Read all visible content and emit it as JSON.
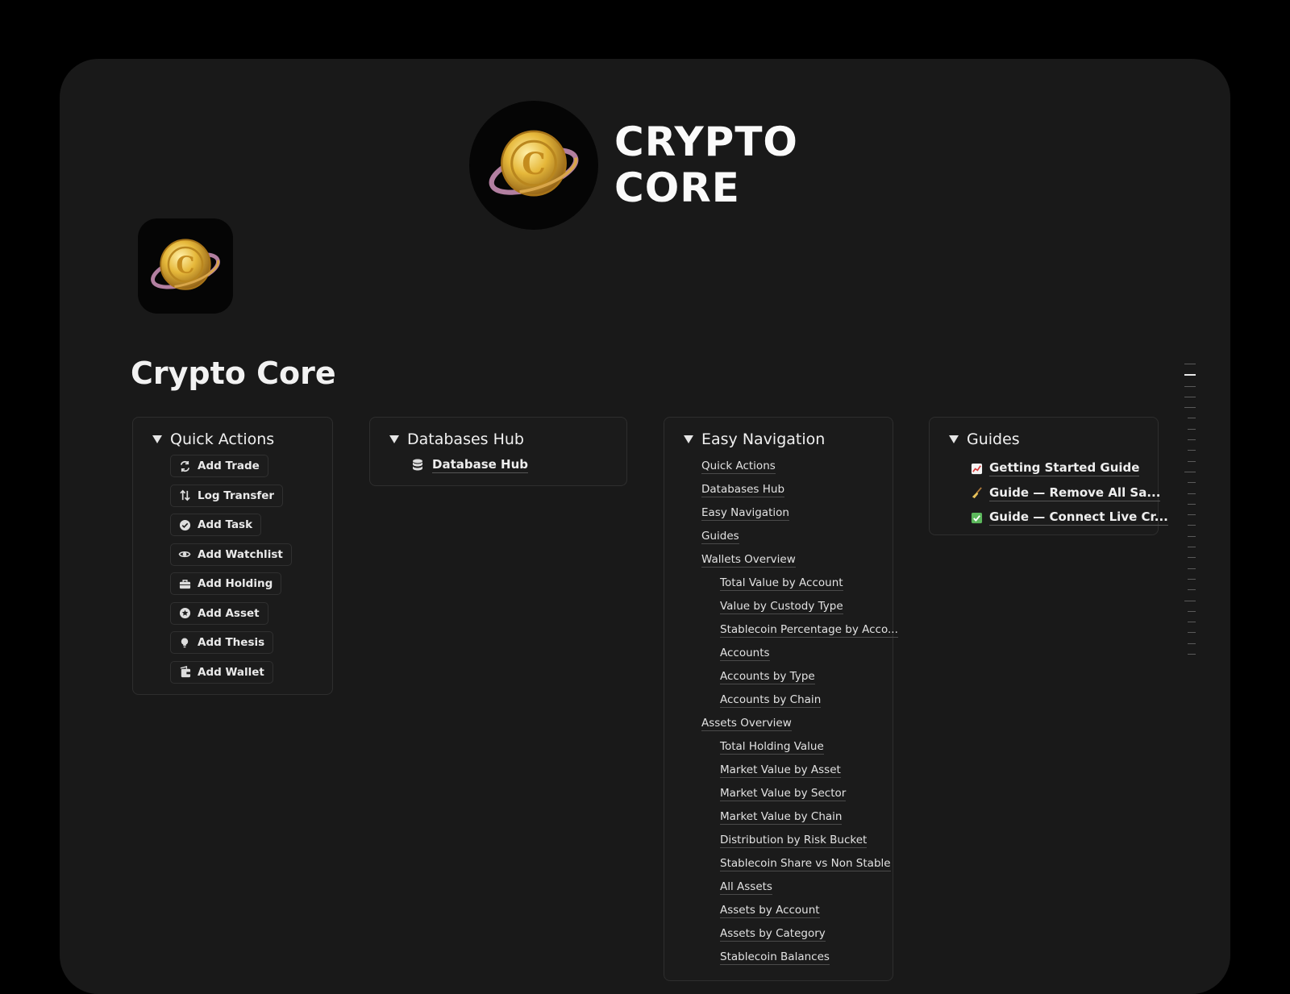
{
  "cover": {
    "title_line1": "CRYPTO",
    "title_line2": "CORE",
    "logo_icon": "gold-coin-orbit-icon"
  },
  "page": {
    "icon": "gold-coin-orbit-icon",
    "title": "Crypto Core"
  },
  "quick_actions": {
    "heading": "Quick Actions",
    "buttons": [
      {
        "label": "Add Trade",
        "icon": "swap-arrows-icon"
      },
      {
        "label": "Log Transfer",
        "icon": "up-down-arrows-icon"
      },
      {
        "label": "Add Task",
        "icon": "check-circle-icon"
      },
      {
        "label": "Add Watchlist",
        "icon": "eye-icon"
      },
      {
        "label": "Add Holding",
        "icon": "briefcase-icon"
      },
      {
        "label": "Add Asset",
        "icon": "star-circle-icon"
      },
      {
        "label": "Add Thesis",
        "icon": "lightbulb-icon"
      },
      {
        "label": "Add Wallet",
        "icon": "wallet-icon"
      }
    ]
  },
  "databases_hub": {
    "heading": "Databases Hub",
    "link": {
      "label": "Database Hub",
      "icon": "database-icon"
    }
  },
  "easy_navigation": {
    "heading": "Easy Navigation",
    "items": [
      {
        "label": "Quick Actions",
        "level": 0
      },
      {
        "label": "Databases Hub",
        "level": 0
      },
      {
        "label": "Easy Navigation",
        "level": 0
      },
      {
        "label": "Guides",
        "level": 0
      },
      {
        "label": "Wallets Overview",
        "level": 0
      },
      {
        "label": "Total Value by Account",
        "level": 1
      },
      {
        "label": "Value by Custody Type",
        "level": 1
      },
      {
        "label": "Stablecoin Percentage by Acco...",
        "level": 1
      },
      {
        "label": "Accounts",
        "level": 1
      },
      {
        "label": "Accounts by Type",
        "level": 1
      },
      {
        "label": "Accounts by Chain",
        "level": 1
      },
      {
        "label": "Assets Overview",
        "level": 0
      },
      {
        "label": "Total Holding Value",
        "level": 1
      },
      {
        "label": "Market Value by Asset",
        "level": 1
      },
      {
        "label": "Market Value by Sector",
        "level": 1
      },
      {
        "label": "Market Value by Chain",
        "level": 1
      },
      {
        "label": "Distribution by Risk Bucket",
        "level": 1
      },
      {
        "label": "Stablecoin Share vs Non Stable",
        "level": 1
      },
      {
        "label": "All Assets",
        "level": 1
      },
      {
        "label": "Assets by Account",
        "level": 1
      },
      {
        "label": "Assets by Category",
        "level": 1
      },
      {
        "label": "Stablecoin Balances",
        "level": 1
      }
    ]
  },
  "guides": {
    "heading": "Guides",
    "links": [
      {
        "label": "Getting Started Guide",
        "icon": "chart-increasing-icon"
      },
      {
        "label": "Guide — Remove All Sa...",
        "icon": "broom-icon"
      },
      {
        "label": "Guide — Connect Live Cr...",
        "icon": "check-mark-button-icon"
      }
    ]
  },
  "colors": {
    "window_bg": "#191919",
    "outer_bg": "#000000",
    "gold": "#e0b23a",
    "card_border": "#2e2e2e"
  }
}
